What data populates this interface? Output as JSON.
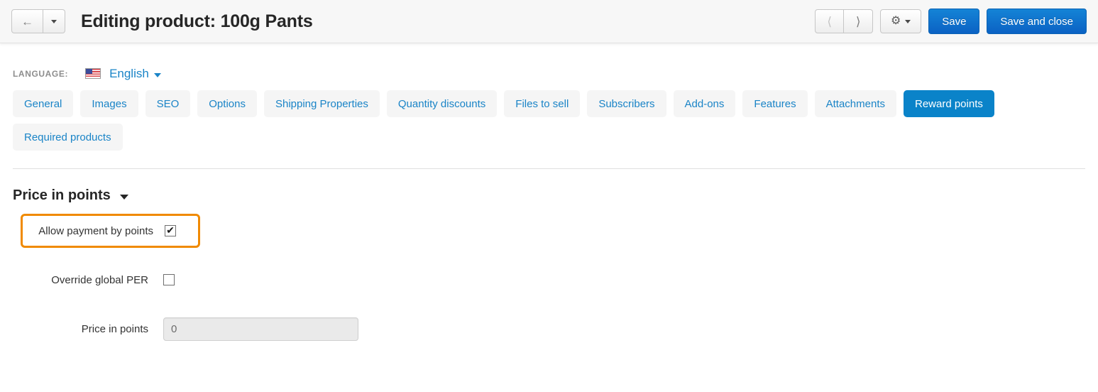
{
  "header": {
    "back_icon": "back-arrow-icon",
    "back_dropdown_icon": "caret-down-icon",
    "title": "Editing product: 100g Pants",
    "prev_icon": "chevron-left-icon",
    "next_icon": "chevron-right-icon",
    "gear_icon": "gear-icon",
    "gear_caret_icon": "caret-down-icon",
    "save_label": "Save",
    "save_and_close_label": "Save and close"
  },
  "language": {
    "label": "LANGUAGE:",
    "flag_icon": "us-flag-icon",
    "name": "English",
    "caret_icon": "caret-down-icon"
  },
  "tabs": [
    {
      "label": "General",
      "active": false
    },
    {
      "label": "Images",
      "active": false
    },
    {
      "label": "SEO",
      "active": false
    },
    {
      "label": "Options",
      "active": false
    },
    {
      "label": "Shipping Properties",
      "active": false
    },
    {
      "label": "Quantity discounts",
      "active": false
    },
    {
      "label": "Files to sell",
      "active": false
    },
    {
      "label": "Subscribers",
      "active": false
    },
    {
      "label": "Add-ons",
      "active": false
    },
    {
      "label": "Features",
      "active": false
    },
    {
      "label": "Attachments",
      "active": false
    },
    {
      "label": "Reward points",
      "active": true
    },
    {
      "label": "Required products",
      "active": false
    }
  ],
  "section": {
    "title": "Price in points",
    "caret_icon": "caret-down-icon"
  },
  "form": {
    "allow_payment": {
      "label": "Allow payment by points",
      "checked": true,
      "checkmark": "✔",
      "highlight_color": "#f08a00"
    },
    "override_per": {
      "label": "Override global PER",
      "checked": false,
      "checkmark": "✔"
    },
    "price_in_points": {
      "label": "Price in points",
      "value": "0",
      "placeholder": "0"
    }
  },
  "colors": {
    "accent_blue": "#0a83c9",
    "link_blue": "#1a84c7",
    "primary_button": "#0b62c4",
    "highlight_orange": "#f08a00",
    "header_bg": "#f7f7f7"
  }
}
